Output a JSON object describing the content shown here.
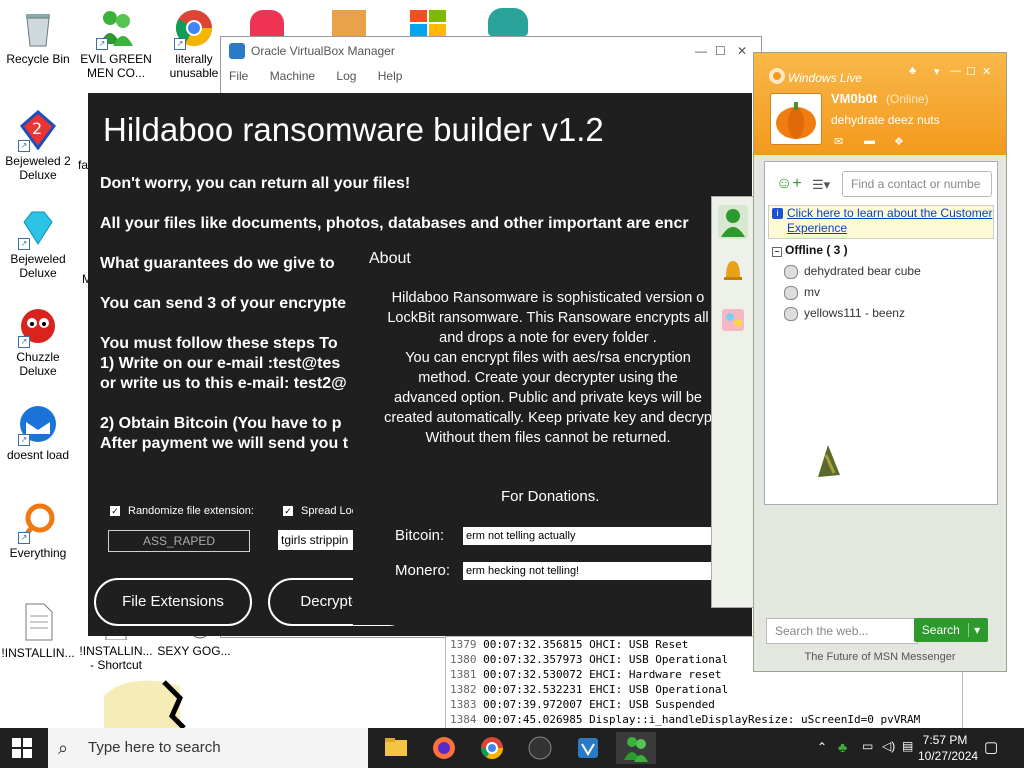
{
  "desktop": {
    "icons": [
      {
        "label": "Recycle Bin"
      },
      {
        "label": "EVIL GREEN MEN CO..."
      },
      {
        "label": "literally unusable"
      },
      {
        "label": "Bejeweled 2 Deluxe"
      },
      {
        "label": "fa"
      },
      {
        "label": "Bejeweled Deluxe"
      },
      {
        "label": "M"
      },
      {
        "label": "Chuzzle Deluxe"
      },
      {
        "label": "doesnt load"
      },
      {
        "label": "Everything"
      },
      {
        "label": "!INSTALLIN..."
      },
      {
        "label": "!INSTALLIN... - Shortcut"
      },
      {
        "label": "SEXY GOG..."
      }
    ]
  },
  "vbox": {
    "title": "Oracle VirtualBox Manager",
    "menu": [
      "File",
      "Machine",
      "Log",
      "Help"
    ]
  },
  "log": {
    "lines": [
      {
        "n": "1379",
        "t": "00:07:32.356815 OHCI: USB Reset"
      },
      {
        "n": "1380",
        "t": "00:07:32.357973 OHCI: USB Operational"
      },
      {
        "n": "1381",
        "t": "00:07:32.530072 EHCI: Hardware reset"
      },
      {
        "n": "1382",
        "t": "00:07:32.532231 EHCI: USB Operational"
      },
      {
        "n": "1383",
        "t": "00:07:39.972007 EHCI: USB Suspended"
      },
      {
        "n": "1384",
        "t": "00:07:45.026985 Display::i_handleDisplayResize: uScreenId=0 pvVRAM"
      }
    ]
  },
  "builder": {
    "title": "Hildaboo ransomware builder v1.2",
    "lines": [
      "Don't worry, you can return all your files!",
      "All your files like documents, photos, databases and other important are encr",
      "What guarantees do we give to",
      "You can send 3 of your encrypte",
      "You must follow these steps To",
      "1) Write on our e-mail :test@tes",
      "or write us to this e-mail: test2@",
      "2) Obtain Bitcoin (You have to p",
      "After payment we will send you t"
    ],
    "check_randomize": "Randomize file extension:",
    "check_spread": "Spread Loc",
    "extension_value": "ASS_RAPED",
    "spread_value": "tgirls strippin",
    "btn_file_extensions": "File Extensions",
    "btn_decrypter": "Decrypter &"
  },
  "about": {
    "heading": "About",
    "body": [
      "Hildaboo Ransomware is sophisticated version o",
      "LockBit ransomware. This Ransoware encrypts all",
      "and drops a note for every folder .",
      "You can  encrypt  files with aes/rsa encryption",
      "method. Create your decrypter using the",
      "advanced option. Public and private keys will be",
      "created automatically. Keep private key and decryp",
      "Without them files cannot be returned."
    ],
    "donations": "For Donations.",
    "bitcoin_label": "Bitcoin:",
    "bitcoin_value": "erm not telling actually",
    "monero_label": "Monero:",
    "monero_value": "erm hecking not telling!"
  },
  "msn": {
    "brand": "Windows Live",
    "username": "VM0b0t",
    "status": "(Online)",
    "personal_message": "dehydrate deez nuts",
    "search_placeholder": "Find a contact or numbe",
    "banner": "Click here to learn about the Customer Experience",
    "group": "Offline ( 3 )",
    "contacts": [
      "dehydrated bear cube",
      "mv",
      "yellows111 - beenz"
    ],
    "web_search_placeholder": "Search the web...",
    "search_button": "Search",
    "footer": "The Future of MSN Messenger"
  },
  "taskbar": {
    "search_placeholder": "Type here to search",
    "time": "7:57 PM",
    "date": "10/27/2024"
  },
  "colors": {
    "builder_bg": "#1f1f1f",
    "msn_orange": "#f39a1c",
    "taskbar_bg": "#202020",
    "msn_search_green": "#2e9a2e"
  }
}
